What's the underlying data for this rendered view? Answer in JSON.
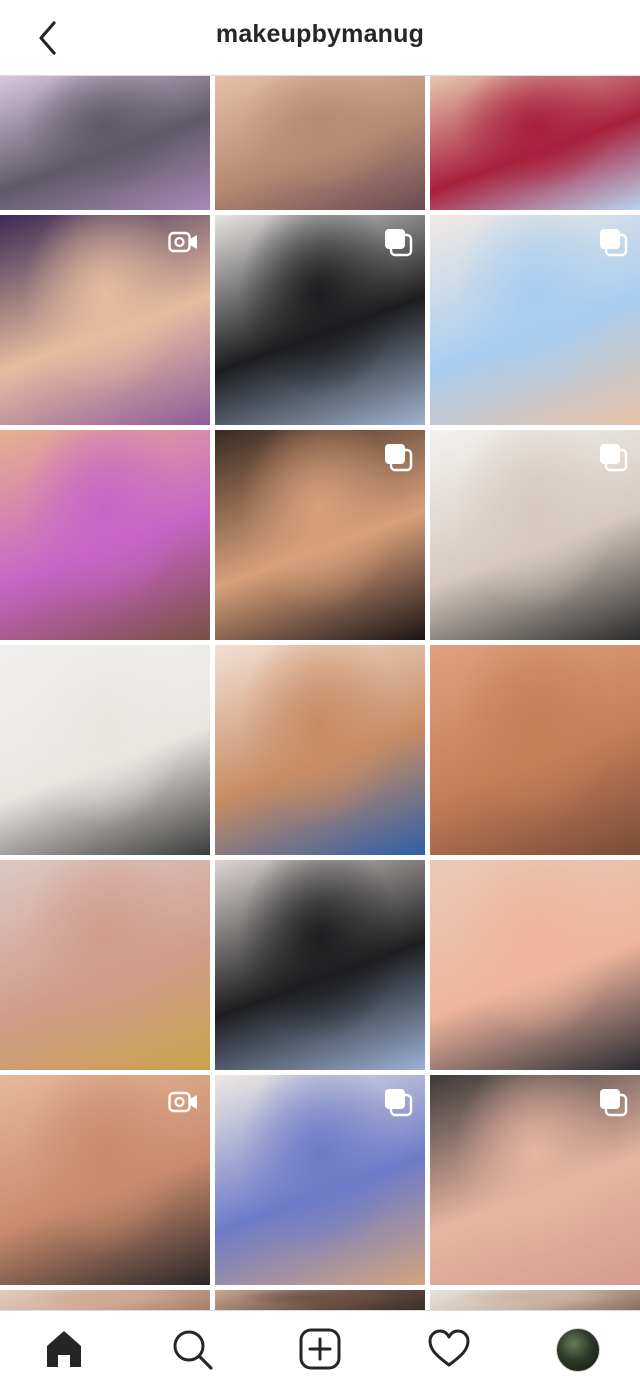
{
  "header": {
    "username": "makeupbymanug"
  },
  "grid": {
    "tiles": [
      {
        "name": "post-tile-1",
        "colors": [
          "#d9c7e0",
          "#5f5a66",
          "#a889b8"
        ],
        "badge": "none"
      },
      {
        "name": "post-tile-2",
        "colors": [
          "#e6c0a9",
          "#b58a73",
          "#6b4a52"
        ],
        "badge": "none"
      },
      {
        "name": "post-tile-3",
        "colors": [
          "#e7c6ad",
          "#a8203d",
          "#b8d5ef"
        ],
        "badge": "none"
      },
      {
        "name": "post-tile-4",
        "colors": [
          "#3b2a55",
          "#e6bda0",
          "#8e5c9a"
        ],
        "badge": "video"
      },
      {
        "name": "post-tile-5",
        "colors": [
          "#e6e4e2",
          "#1c1c1e",
          "#9fb3cf"
        ],
        "badge": "carousel"
      },
      {
        "name": "post-tile-6",
        "colors": [
          "#f1e9e3",
          "#a9cdef",
          "#e7c2a6"
        ],
        "badge": "carousel"
      },
      {
        "name": "post-tile-7",
        "colors": [
          "#e5b18f",
          "#c964c7",
          "#7a5044"
        ],
        "badge": "none"
      },
      {
        "name": "post-tile-8",
        "colors": [
          "#3a2a22",
          "#d9a07a",
          "#1b1416"
        ],
        "badge": "carousel"
      },
      {
        "name": "post-tile-9",
        "colors": [
          "#f3f2f0",
          "#d5c9bf",
          "#2c2c2c"
        ],
        "badge": "carousel"
      },
      {
        "name": "post-tile-10",
        "colors": [
          "#f1f0ee",
          "#e9e6e2",
          "#3b3b3b"
        ],
        "badge": "none"
      },
      {
        "name": "post-tile-11",
        "colors": [
          "#f2e0d4",
          "#c88c64",
          "#2f5fa7"
        ],
        "badge": "none"
      },
      {
        "name": "post-tile-12",
        "colors": [
          "#e0a17f",
          "#c47e58",
          "#7a4c36"
        ],
        "badge": "none"
      },
      {
        "name": "post-tile-13",
        "colors": [
          "#dcc9c1",
          "#d19c8c",
          "#c9a24d"
        ],
        "badge": "none"
      },
      {
        "name": "post-tile-14",
        "colors": [
          "#dcd6d3",
          "#1d1d1f",
          "#9bb2d6"
        ],
        "badge": "none"
      },
      {
        "name": "post-tile-15",
        "colors": [
          "#e8c9b6",
          "#f0b59e",
          "#2a2c33"
        ],
        "badge": "none"
      },
      {
        "name": "post-tile-16",
        "colors": [
          "#e6b899",
          "#c98b6c",
          "#2b2628"
        ],
        "badge": "video"
      },
      {
        "name": "post-tile-17",
        "colors": [
          "#efe9e2",
          "#6c7bc8",
          "#d3a47f"
        ],
        "badge": "carousel"
      },
      {
        "name": "post-tile-18",
        "colors": [
          "#3c3a3b",
          "#e7b5a1",
          "#d49b8e"
        ],
        "badge": "carousel"
      },
      {
        "name": "post-tile-19",
        "colors": [
          "#e3ccbe",
          "#cfa792",
          "#a67f69"
        ],
        "badge": "none"
      },
      {
        "name": "post-tile-20",
        "colors": [
          "#caa790",
          "#6b5146",
          "#3a2f2a"
        ],
        "badge": "none"
      },
      {
        "name": "post-tile-21",
        "colors": [
          "#e7e3df",
          "#c8b3a2",
          "#8b6d5b"
        ],
        "badge": "none"
      }
    ]
  },
  "tabbar": {
    "items": [
      {
        "name": "home-tab",
        "icon": "home-icon"
      },
      {
        "name": "search-tab",
        "icon": "search-icon"
      },
      {
        "name": "create-tab",
        "icon": "add-post-icon"
      },
      {
        "name": "activity-tab",
        "icon": "heart-icon"
      },
      {
        "name": "profile-tab",
        "icon": "avatar"
      }
    ]
  }
}
